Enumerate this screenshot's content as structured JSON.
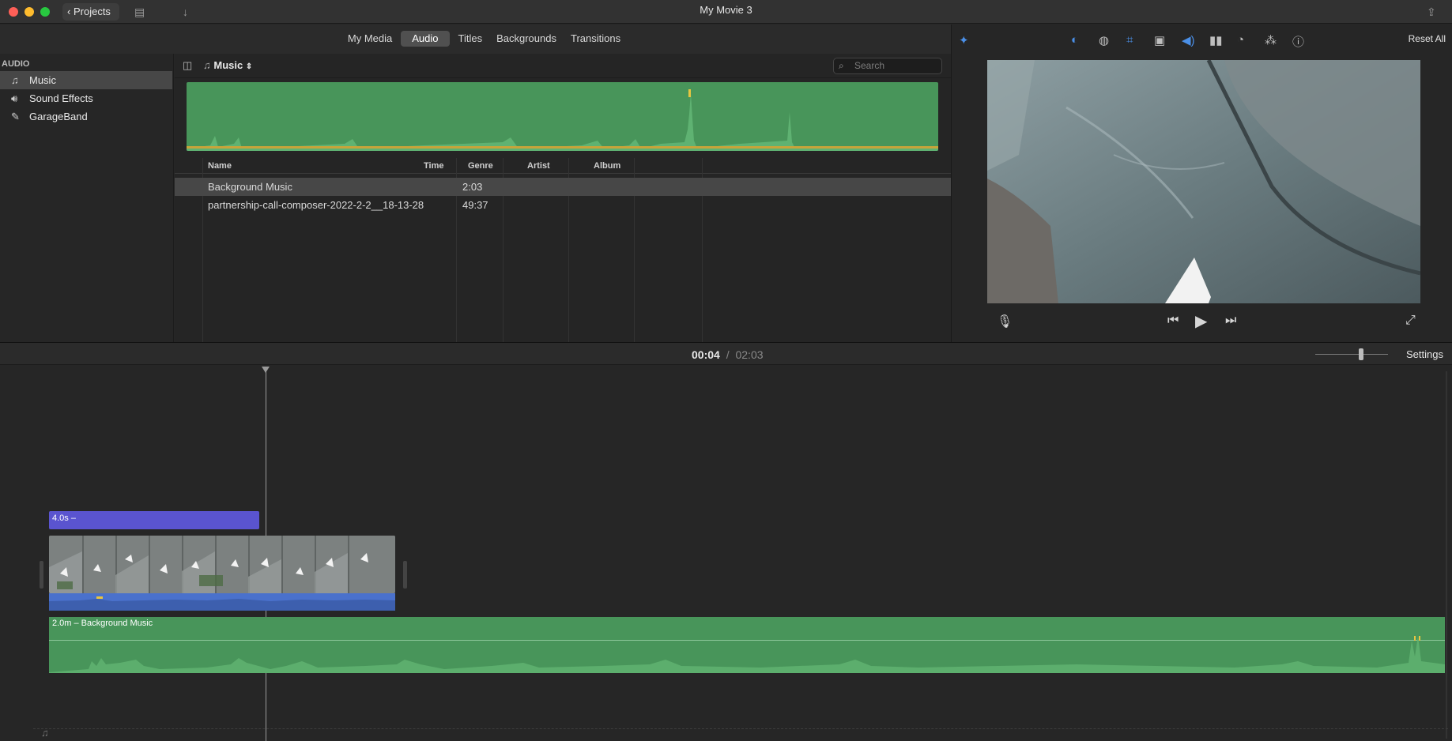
{
  "window": {
    "title": "My Movie 3"
  },
  "toolbar": {
    "projects_label": "Projects"
  },
  "media_tabs": [
    {
      "label": "My Media",
      "active": false
    },
    {
      "label": "Audio",
      "active": true
    },
    {
      "label": "Titles",
      "active": false
    },
    {
      "label": "Backgrounds",
      "active": false
    },
    {
      "label": "Transitions",
      "active": false
    }
  ],
  "sidebar": {
    "heading": "AUDIO",
    "items": [
      {
        "label": "Music",
        "icon": "music-icon",
        "selected": true
      },
      {
        "label": "Sound Effects",
        "icon": "speaker-icon",
        "selected": false
      },
      {
        "label": "GarageBand",
        "icon": "guitar-icon",
        "selected": false
      }
    ]
  },
  "browser": {
    "source_label": "Music",
    "search_placeholder": "Search",
    "columns": [
      "Name",
      "Time",
      "Genre",
      "Artist",
      "Album"
    ],
    "rows": [
      {
        "name": "Background Music",
        "time": "2:03",
        "genre": "",
        "artist": "",
        "album": "",
        "selected": true
      },
      {
        "name": "partnership-call-composer-2022-2-2__18-13-28",
        "time": "49:37",
        "genre": "",
        "artist": "",
        "album": "",
        "selected": false
      }
    ]
  },
  "inspector": {
    "reset_label": "Reset All",
    "icons": [
      "magic-wand-icon",
      "color-balance-icon",
      "color-correction-icon",
      "crop-icon",
      "stabilization-icon",
      "volume-icon",
      "noise-reduction-icon",
      "speed-icon",
      "clip-filter-icon",
      "info-icon"
    ]
  },
  "playback": {
    "current_time": "00:04",
    "separator": "/",
    "total_time": "02:03",
    "settings_label": "Settings"
  },
  "timeline": {
    "title_clip_label": "4.0s –",
    "music_clip_label": "2.0m – Background Music"
  },
  "colors": {
    "audio_green": "#48955a",
    "title_purple": "#5a54cf",
    "clip_audio_blue": "#4a71cc",
    "accent_blue": "#4a8fe7"
  }
}
